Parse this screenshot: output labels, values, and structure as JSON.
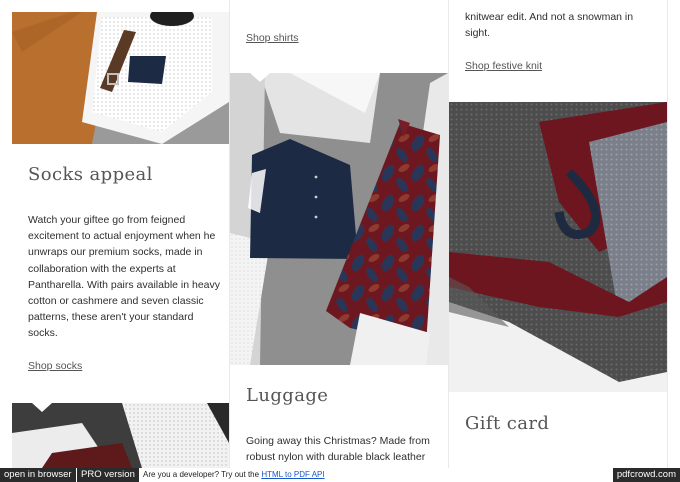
{
  "columns": {
    "col1": {
      "title": "Socks appeal",
      "body": "Watch your giftee go from feigned excitement to actual enjoyment when he unwraps our premium socks, made in collaboration with the experts at Pantharella. With pairs available in heavy cotton or cashmere and seven classic patterns, these aren't your standard socks.",
      "link": "Shop socks"
    },
    "col2": {
      "top_link": "Shop shirts",
      "title": "Luggage",
      "body": "Going away this Christmas? Made from robust nylon with durable black leather"
    },
    "col3": {
      "top_text": "knitwear edit. And not a snowman in sight.",
      "top_link": "Shop festive knit",
      "title": "Gift card"
    }
  },
  "banner": {
    "open_in_browser": "open in browser",
    "pro_version": "PRO version",
    "dev_text": "Are you a developer? Try out the",
    "api_link": "HTML to PDF API",
    "brand": "pdfcrowd.com"
  },
  "colors": {
    "text": "#2f2f2f",
    "shirt_rust": "#b46a30",
    "navy": "#1c2a44",
    "burgundy": "#6f1620",
    "knit_grey": "#4a4a4a"
  }
}
